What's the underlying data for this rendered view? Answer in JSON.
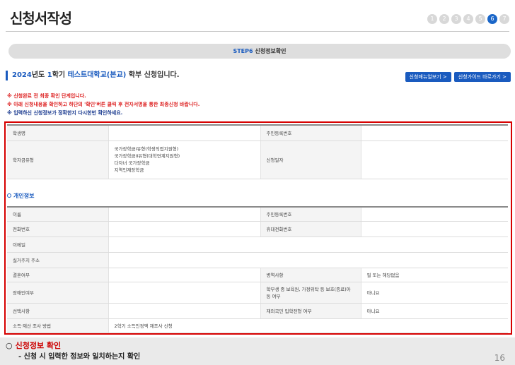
{
  "page_title": "신청서작성",
  "steps": [
    "1",
    "2",
    "3",
    "4",
    "5",
    "6",
    "7"
  ],
  "active_step": "6",
  "colors": {
    "accent": "#1a5bbf",
    "warning": "#d22222",
    "highlight_frame": "#d60000"
  },
  "banner": {
    "step_code": "STEP6",
    "step_name": "신청정보확인"
  },
  "heading": {
    "year": "2024",
    "year_suffix": "년도 ",
    "term": "1",
    "term_suffix": "학기 ",
    "school": "테스트대학교(본교)",
    "degree": " 학부",
    "tail": " 신청입니다."
  },
  "buttons": {
    "manual": "신청매뉴얼보기 >",
    "guide": "신청가이드 바로가기 >"
  },
  "notices": [
    "※ 신청완료 전 최종 확인 단계입니다.",
    "※ 아래 신청내용을 확인하고 하단의 '확인'버튼 클릭 후 전자서명을 통한 최종신청 바랍니다.",
    "※ 입력하신 신청정보가 정확한지 다시한번 확인하세요."
  ],
  "summary": {
    "student_name_label": "학생명",
    "resident_no_label": "주민등록번호",
    "scholarship_type_label": "학자금유형",
    "scholarship_types": [
      "국가장학금I유형(학생직접지원형)",
      "국가장학금II유형(대학연계지원형)",
      "다자녀 국가장학금",
      "지역인재장학금"
    ],
    "apply_date_label": "신청일자"
  },
  "personal": {
    "section_title": "개인정보",
    "name_label": "이름",
    "resident_no_label": "주민등록번호",
    "phone_label": "전화번호",
    "mobile_label": "휴대전화번호",
    "email_label": "이메일",
    "address_label": "실거주지 주소",
    "marital_label": "결혼여부",
    "military_label": "병역사항",
    "military_value": "필 또는 해당없음",
    "disabled_label": "장애인여부",
    "protect_label": "학부생 중 보육원, 가정위탁 등 보호(종료)아동 여부",
    "protect_value": "아니요",
    "choice_label": "선택사항",
    "overseas_label": "재외국민 입학전형 여부",
    "overseas_value": "아니요",
    "income_method_label": "소득·재산 조사 방법",
    "income_method_value": "2학기 소득인정액 재조사 신청"
  },
  "caption": {
    "bullet": "○",
    "title": "신청정보 확인",
    "desc": "- 신청 시 입력한 정보와 일치하는지 확인",
    "page_number": "16"
  }
}
